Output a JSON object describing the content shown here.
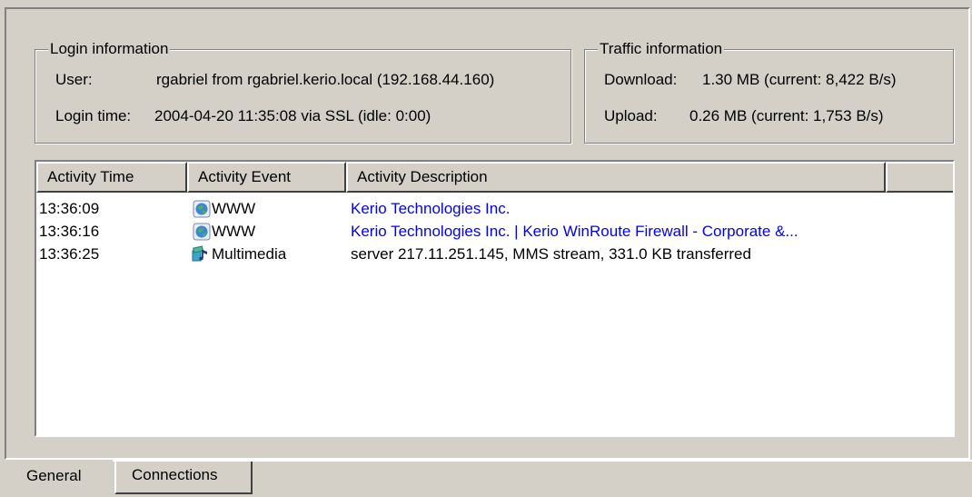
{
  "login": {
    "title": "Login information",
    "user_label": "User:",
    "user_value": "rgabriel from rgabriel.kerio.local (192.168.44.160)",
    "login_time_label": "Login time:",
    "login_time_value": "2004-04-20 11:35:08 via SSL (idle: 0:00)"
  },
  "traffic": {
    "title": "Traffic information",
    "download_label": "Download:",
    "download_value": "1.30 MB (current: 8,422 B/s)",
    "upload_label": "Upload:",
    "upload_value": "0.26 MB (current: 1,753 B/s)"
  },
  "activity": {
    "columns": [
      "Activity Time",
      "Activity Event",
      "Activity Description",
      ""
    ],
    "rows": [
      {
        "time": "13:36:09",
        "event": "WWW",
        "icon": "globe-icon",
        "description": "Kerio Technologies Inc.",
        "link": true
      },
      {
        "time": "13:36:16",
        "event": "WWW",
        "icon": "globe-icon",
        "description": "Kerio Technologies Inc. | Kerio WinRoute Firewall - Corporate &...",
        "link": true
      },
      {
        "time": "13:36:25",
        "event": "Multimedia",
        "icon": "multimedia-icon",
        "description": "server 217.11.251.145, MMS stream, 331.0 KB transferred",
        "link": false
      }
    ]
  },
  "tabs": {
    "general": "General",
    "connections": "Connections"
  },
  "colors": {
    "background": "#d4d0c8",
    "link": "#0000ff",
    "list_background": "#ffffff"
  }
}
